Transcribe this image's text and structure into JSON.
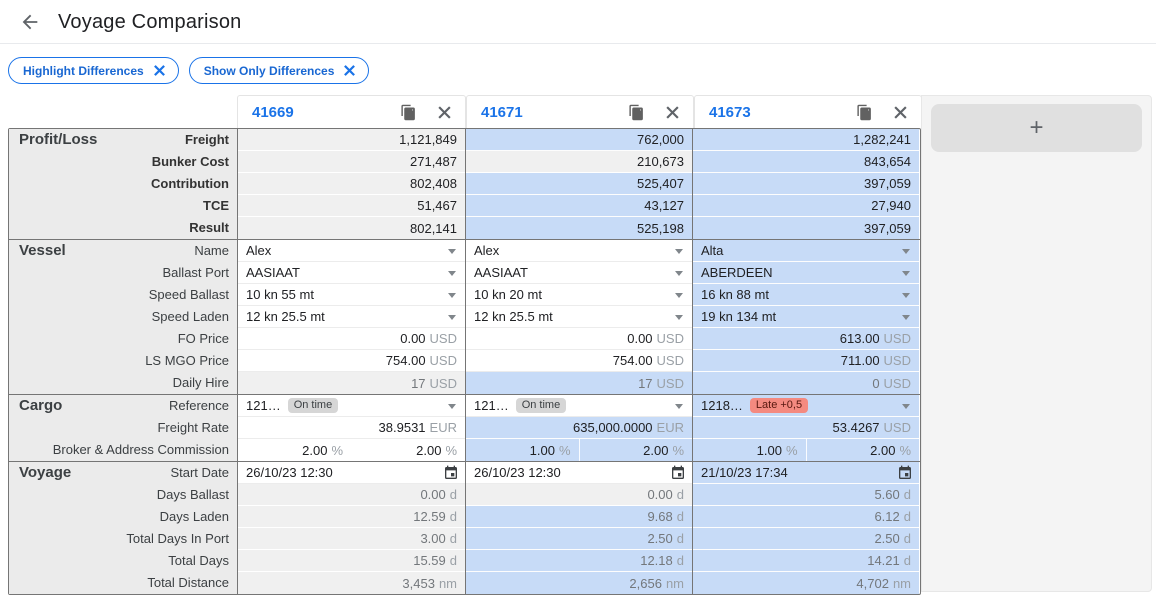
{
  "header": {
    "title": "Voyage Comparison"
  },
  "filters": {
    "chips": [
      {
        "label": "Highlight Differences"
      },
      {
        "label": "Show Only Differences"
      }
    ]
  },
  "columns": [
    {
      "id": "41669"
    },
    {
      "id": "41671"
    },
    {
      "id": "41673"
    }
  ],
  "add_column_label": "+",
  "colors": {
    "accent_blue": "#1a73e8",
    "difference_highlight": "#c7dbf7",
    "readonly_gray": "#f0f0f0",
    "label_column_bg": "#ebebeb",
    "late_badge_bg": "#f48a80",
    "ontime_badge_bg": "#d6d6d6"
  },
  "sections": [
    {
      "name": "Profit/Loss",
      "bold_labels": true,
      "rows": [
        {
          "label": "Freight",
          "cells": [
            {
              "type": "num",
              "v": "1,121,849",
              "bg": "gray",
              "editable": false
            },
            {
              "type": "num",
              "v": "762,000",
              "bg": "blue",
              "editable": false
            },
            {
              "type": "num",
              "v": "1,282,241",
              "bg": "blue",
              "editable": false
            }
          ]
        },
        {
          "label": "Bunker Cost",
          "cells": [
            {
              "type": "num",
              "v": "271,487",
              "bg": "gray",
              "editable": false
            },
            {
              "type": "num",
              "v": "210,673",
              "bg": "gray",
              "editable": false
            },
            {
              "type": "num",
              "v": "843,654",
              "bg": "blue",
              "editable": false
            }
          ]
        },
        {
          "label": "Contribution",
          "cells": [
            {
              "type": "num",
              "v": "802,408",
              "bg": "gray",
              "editable": false
            },
            {
              "type": "num",
              "v": "525,407",
              "bg": "blue",
              "editable": false
            },
            {
              "type": "num",
              "v": "397,059",
              "bg": "blue",
              "editable": false
            }
          ]
        },
        {
          "label": "TCE",
          "cells": [
            {
              "type": "num",
              "v": "51,467",
              "bg": "gray",
              "editable": false
            },
            {
              "type": "num",
              "v": "43,127",
              "bg": "blue",
              "editable": false
            },
            {
              "type": "num",
              "v": "27,940",
              "bg": "blue",
              "editable": false
            }
          ]
        },
        {
          "label": "Result",
          "cells": [
            {
              "type": "num",
              "v": "802,141",
              "bg": "gray",
              "editable": false
            },
            {
              "type": "num",
              "v": "525,198",
              "bg": "blue",
              "editable": false
            },
            {
              "type": "num",
              "v": "397,059",
              "bg": "blue",
              "editable": false
            }
          ]
        }
      ]
    },
    {
      "name": "Vessel",
      "bold_labels": false,
      "rows": [
        {
          "label": "Name",
          "cells": [
            {
              "type": "dropdown",
              "v": "Alex",
              "bg": "white",
              "editable": true
            },
            {
              "type": "dropdown",
              "v": "Alex",
              "bg": "white",
              "editable": true
            },
            {
              "type": "dropdown",
              "v": "Alta",
              "bg": "blue",
              "editable": true
            }
          ]
        },
        {
          "label": "Ballast Port",
          "cells": [
            {
              "type": "dropdown",
              "v": "AASIAAT",
              "bg": "white",
              "editable": true
            },
            {
              "type": "dropdown",
              "v": "AASIAAT",
              "bg": "white",
              "editable": true
            },
            {
              "type": "dropdown",
              "v": "ABERDEEN",
              "bg": "blue",
              "editable": true
            }
          ]
        },
        {
          "label": "Speed Ballast",
          "cells": [
            {
              "type": "dropdown",
              "v": "10 kn 55 mt",
              "bg": "white",
              "editable": true
            },
            {
              "type": "dropdown",
              "v": "10 kn 20 mt",
              "bg": "white",
              "editable": true
            },
            {
              "type": "dropdown",
              "v": "16 kn 88 mt",
              "bg": "blue",
              "editable": true
            }
          ]
        },
        {
          "label": "Speed Laden",
          "cells": [
            {
              "type": "dropdown",
              "v": "12 kn 25.5 mt",
              "bg": "white",
              "editable": true
            },
            {
              "type": "dropdown",
              "v": "12 kn 25.5 mt",
              "bg": "white",
              "editable": true
            },
            {
              "type": "dropdown",
              "v": "19 kn 134 mt",
              "bg": "blue",
              "editable": true
            }
          ]
        },
        {
          "label": "FO Price",
          "cells": [
            {
              "type": "num",
              "v": "0.00",
              "unit": "USD",
              "bg": "white",
              "editable": true
            },
            {
              "type": "num",
              "v": "0.00",
              "unit": "USD",
              "bg": "white",
              "editable": true
            },
            {
              "type": "num",
              "v": "613.00",
              "unit": "USD",
              "bg": "blue",
              "editable": true
            }
          ]
        },
        {
          "label": "LS MGO Price",
          "cells": [
            {
              "type": "num",
              "v": "754.00",
              "unit": "USD",
              "bg": "white",
              "editable": true
            },
            {
              "type": "num",
              "v": "754.00",
              "unit": "USD",
              "bg": "white",
              "editable": true
            },
            {
              "type": "num",
              "v": "711.00",
              "unit": "USD",
              "bg": "blue",
              "editable": true
            }
          ]
        },
        {
          "label": "Daily Hire",
          "cells": [
            {
              "type": "num",
              "v": "17",
              "unit": "USD",
              "bg": "gray",
              "muted": true,
              "editable": false
            },
            {
              "type": "num",
              "v": "17",
              "unit": "USD",
              "bg": "blue",
              "muted": true,
              "editable": false
            },
            {
              "type": "num",
              "v": "0",
              "unit": "USD",
              "bg": "blue",
              "muted": true,
              "editable": false
            }
          ]
        }
      ]
    },
    {
      "name": "Cargo",
      "bold_labels": false,
      "rows": [
        {
          "label": "Reference",
          "cells": [
            {
              "type": "dropdown",
              "v": "121…",
              "bg": "white",
              "badge": "On time",
              "badge_color": "gray",
              "editable": true
            },
            {
              "type": "dropdown",
              "v": "121…",
              "bg": "white",
              "badge": "On time",
              "badge_color": "gray",
              "editable": true
            },
            {
              "type": "dropdown",
              "v": "1218…",
              "bg": "blue",
              "badge": "Late +0,5",
              "badge_color": "red",
              "editable": true
            }
          ]
        },
        {
          "label": "Freight Rate",
          "cells": [
            {
              "type": "num",
              "v": "38.9531",
              "unit": "EUR",
              "bg": "white",
              "editable": true
            },
            {
              "type": "num",
              "v": "635,000.0000",
              "unit": "EUR",
              "bg": "blue",
              "editable": true
            },
            {
              "type": "num",
              "v": "53.4267",
              "unit": "USD",
              "bg": "blue",
              "editable": true
            }
          ]
        },
        {
          "label": "Broker & Address Commission",
          "cells": [
            {
              "type": "split",
              "split": [
                {
                  "v": "2.00",
                  "unit": "%"
                },
                {
                  "v": "2.00",
                  "unit": "%"
                }
              ],
              "bg": "white",
              "editable": true
            },
            {
              "type": "split",
              "split": [
                {
                  "v": "1.00",
                  "unit": "%"
                },
                {
                  "v": "2.00",
                  "unit": "%"
                }
              ],
              "bg": "blue",
              "editable": true
            },
            {
              "type": "split",
              "split": [
                {
                  "v": "1.00",
                  "unit": "%"
                },
                {
                  "v": "2.00",
                  "unit": "%"
                }
              ],
              "bg": "blue",
              "editable": true
            }
          ]
        }
      ]
    },
    {
      "name": "Voyage",
      "bold_labels": false,
      "rows": [
        {
          "label": "Start Date",
          "cells": [
            {
              "type": "date",
              "v": "26/10/23 12:30",
              "bg": "white",
              "editable": true
            },
            {
              "type": "date",
              "v": "26/10/23 12:30",
              "bg": "white",
              "editable": true
            },
            {
              "type": "date",
              "v": "21/10/23 17:34",
              "bg": "blue",
              "editable": true
            }
          ]
        },
        {
          "label": "Days Ballast",
          "cells": [
            {
              "type": "num",
              "v": "0.00",
              "unit": "d",
              "bg": "gray",
              "muted": true,
              "editable": false
            },
            {
              "type": "num",
              "v": "0.00",
              "unit": "d",
              "bg": "gray",
              "muted": true,
              "editable": false
            },
            {
              "type": "num",
              "v": "5.60",
              "unit": "d",
              "bg": "blue",
              "muted": true,
              "editable": false
            }
          ]
        },
        {
          "label": "Days Laden",
          "cells": [
            {
              "type": "num",
              "v": "12.59",
              "unit": "d",
              "bg": "gray",
              "muted": true,
              "editable": false
            },
            {
              "type": "num",
              "v": "9.68",
              "unit": "d",
              "bg": "blue",
              "muted": true,
              "editable": false
            },
            {
              "type": "num",
              "v": "6.12",
              "unit": "d",
              "bg": "blue",
              "muted": true,
              "editable": false
            }
          ]
        },
        {
          "label": "Total Days In Port",
          "cells": [
            {
              "type": "num",
              "v": "3.00",
              "unit": "d",
              "bg": "gray",
              "muted": true,
              "editable": false
            },
            {
              "type": "num",
              "v": "2.50",
              "unit": "d",
              "bg": "blue",
              "muted": true,
              "editable": false
            },
            {
              "type": "num",
              "v": "2.50",
              "unit": "d",
              "bg": "blue",
              "muted": true,
              "editable": false
            }
          ]
        },
        {
          "label": "Total Days",
          "cells": [
            {
              "type": "num",
              "v": "15.59",
              "unit": "d",
              "bg": "gray",
              "muted": true,
              "editable": false
            },
            {
              "type": "num",
              "v": "12.18",
              "unit": "d",
              "bg": "blue",
              "muted": true,
              "editable": false
            },
            {
              "type": "num",
              "v": "14.21",
              "unit": "d",
              "bg": "blue",
              "muted": true,
              "editable": false
            }
          ]
        },
        {
          "label": "Total Distance",
          "cells": [
            {
              "type": "num",
              "v": "3,453",
              "unit": "nm",
              "bg": "gray",
              "muted": true,
              "editable": false
            },
            {
              "type": "num",
              "v": "2,656",
              "unit": "nm",
              "bg": "blue",
              "muted": true,
              "editable": false
            },
            {
              "type": "num",
              "v": "4,702",
              "unit": "nm",
              "bg": "blue",
              "muted": true,
              "editable": false
            }
          ]
        }
      ]
    }
  ]
}
